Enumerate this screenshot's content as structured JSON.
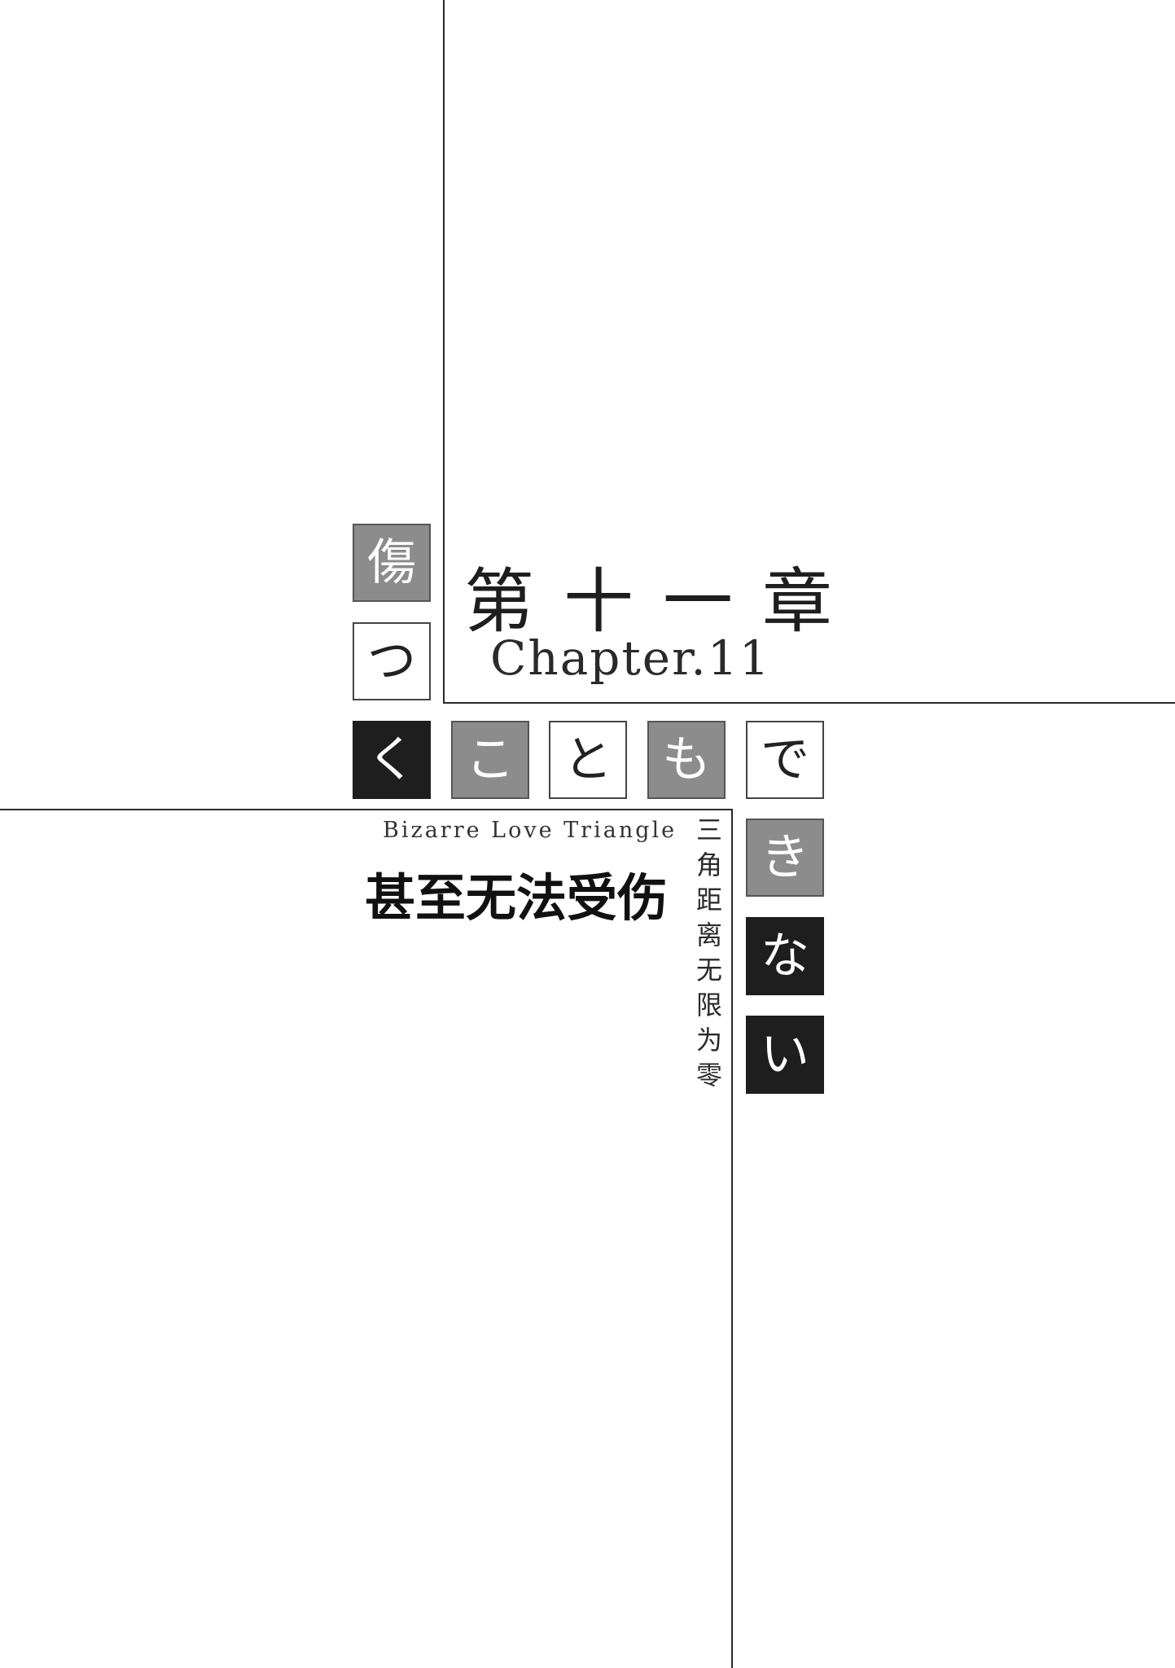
{
  "title_tiles": [
    {
      "char": "傷",
      "style": "gray"
    },
    {
      "char": "つ",
      "style": "white"
    },
    {
      "char": "く",
      "style": "black"
    },
    {
      "char": "こ",
      "style": "gray"
    },
    {
      "char": "と",
      "style": "white"
    },
    {
      "char": "も",
      "style": "gray"
    },
    {
      "char": "で",
      "style": "white"
    },
    {
      "char": "き",
      "style": "gray"
    },
    {
      "char": "な",
      "style": "black"
    },
    {
      "char": "い",
      "style": "black"
    }
  ],
  "chapter": {
    "cn": "第十一章",
    "en": "Chapter.11"
  },
  "series": {
    "en": "Bizarre Love Triangle",
    "cn": "三角距离无限为零"
  },
  "subtitle_cn": "甚至无法受伤"
}
